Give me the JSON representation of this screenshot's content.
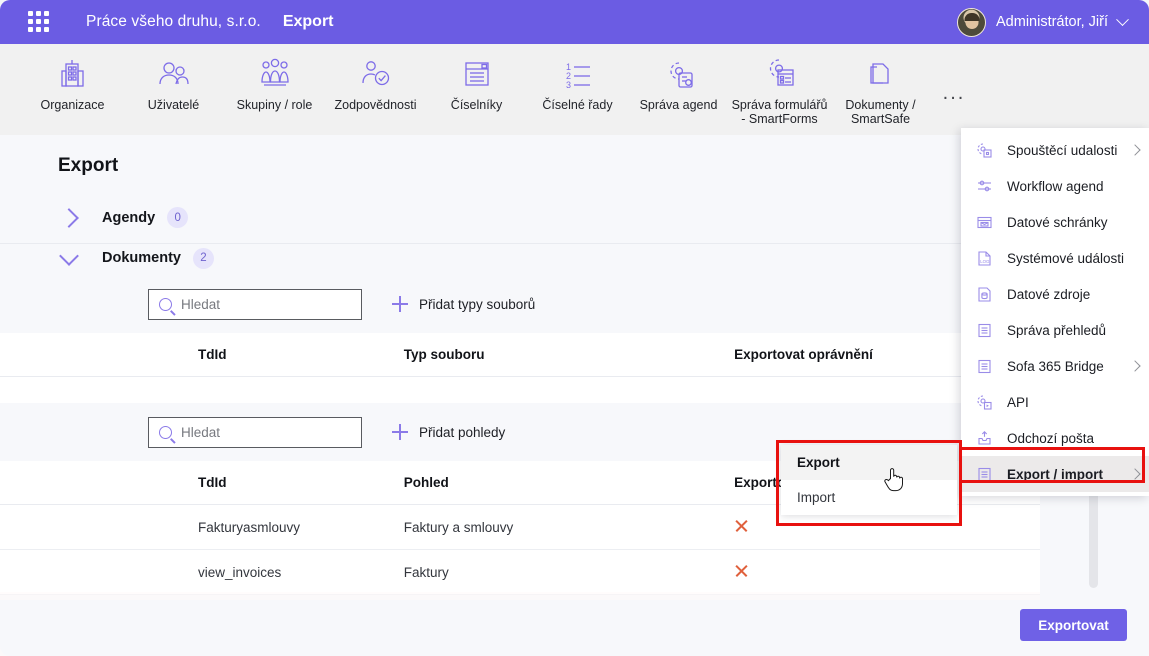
{
  "header": {
    "waffle_icon": "grid-apps-icon",
    "org_name": "Práce všeho druhu, s.r.o.",
    "app_name": "Export",
    "user_name": "Administrátor, Jiří",
    "accent_color": "#6b5ce3"
  },
  "ribbon": {
    "items": [
      {
        "label": "Organizace",
        "icon": "building-icon"
      },
      {
        "label": "Uživatelé",
        "icon": "users-icon"
      },
      {
        "label": "Skupiny / role",
        "icon": "group-roles-icon"
      },
      {
        "label": "Zodpovědnosti",
        "icon": "user-check-icon"
      },
      {
        "label": "Číselníky",
        "icon": "list-window-icon"
      },
      {
        "label": "Číselné řady",
        "icon": "numbered-list-icon"
      },
      {
        "label": "Správa agend",
        "icon": "gear-clipboard-icon"
      },
      {
        "label": "Správa formulářů - SmartForms",
        "icon": "gear-form-icon"
      },
      {
        "label": "Dokumenty / SmartSafe",
        "icon": "documents-icon"
      }
    ],
    "more_label": "..."
  },
  "page": {
    "title": "Export",
    "sections": [
      {
        "name": "Agendy",
        "count": "0",
        "expanded": false,
        "chevron": "chevron-right-icon"
      },
      {
        "name": "Dokumenty",
        "count": "2",
        "expanded": true,
        "chevron": "chevron-down-icon"
      }
    ]
  },
  "filetypes_panel": {
    "search_placeholder": "Hledat",
    "search_value": "",
    "add_label": "Přidat typy souborů",
    "columns": [
      "TdId",
      "Typ souboru",
      "Exportovat oprávnění"
    ],
    "rows": []
  },
  "views_panel": {
    "search_placeholder": "Hledat",
    "search_value": "",
    "add_label": "Přidat pohledy",
    "columns": [
      "TdId",
      "Pohled",
      "Exportovat oprávnění"
    ],
    "rows": [
      {
        "tdid": "Fakturyasmlouvy",
        "pohled": "Faktury a smlouvy",
        "action": "remove-icon"
      },
      {
        "tdid": "view_invoices",
        "pohled": "Faktury",
        "action": "remove-icon"
      }
    ]
  },
  "footer": {
    "export_button": "Exportovat"
  },
  "menu": {
    "items": [
      {
        "label": "Spouštěcí udalosti",
        "icon": "gear-events-icon",
        "has_submenu": true,
        "selected": false
      },
      {
        "label": "Workflow agend",
        "icon": "workflow-icon",
        "has_submenu": false,
        "selected": false
      },
      {
        "label": "Datové schránky",
        "icon": "mailbox-icon",
        "has_submenu": false,
        "selected": false
      },
      {
        "label": "Systémové události",
        "icon": "log-file-icon",
        "has_submenu": false,
        "selected": false
      },
      {
        "label": "Datové zdroje",
        "icon": "database-file-icon",
        "has_submenu": false,
        "selected": false
      },
      {
        "label": "Správa přehledů",
        "icon": "report-icon",
        "has_submenu": false,
        "selected": false
      },
      {
        "label": "Sofa 365 Bridge",
        "icon": "report-icon",
        "has_submenu": true,
        "selected": false
      },
      {
        "label": "API",
        "icon": "gear-api-icon",
        "has_submenu": false,
        "selected": false
      },
      {
        "label": "Odchozí pošta",
        "icon": "outbox-icon",
        "has_submenu": false,
        "selected": false
      },
      {
        "label": "Export / import",
        "icon": "report-icon",
        "has_submenu": true,
        "selected": true
      }
    ]
  },
  "submenu": {
    "items": [
      {
        "label": "Export",
        "active": true
      },
      {
        "label": "Import",
        "active": false
      }
    ]
  },
  "highlight_color": "#e8110f"
}
